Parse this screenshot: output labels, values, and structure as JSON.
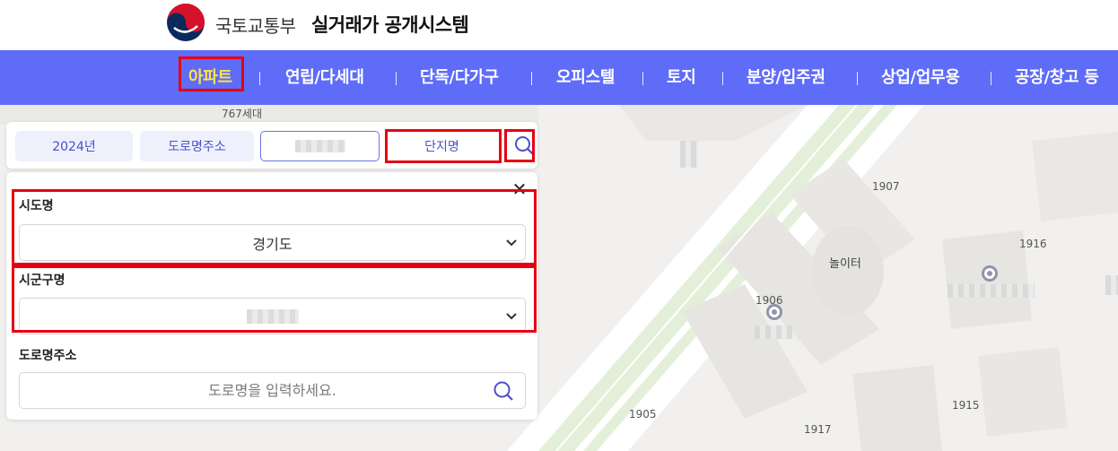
{
  "header": {
    "org_name": "국토교통부",
    "system_name": "실거래가 공개시스템"
  },
  "nav": {
    "items": [
      {
        "label": "아파트",
        "active": true
      },
      {
        "label": "연립/다세대"
      },
      {
        "label": "단독/다가구"
      },
      {
        "label": "오피스텔"
      },
      {
        "label": "토지"
      },
      {
        "label": "분양/입주권"
      },
      {
        "label": "상업/업무용"
      },
      {
        "label": "공장/창고 등"
      }
    ]
  },
  "filter_bar": {
    "year": "2024년",
    "road_address": "도로명주소",
    "complex_name": "단지명",
    "search_icon": "search-icon"
  },
  "panel": {
    "close_icon": "close-icon",
    "sido_label": "시도명",
    "sido_value": "경기도",
    "sigungu_label": "시군구명",
    "road_label": "도로명주소",
    "road_placeholder": "도로명을 입력하세요."
  },
  "map": {
    "labels": {
      "households": "767세대",
      "b1907": "1907",
      "b1916": "1916",
      "b1906": "1906",
      "b1905": "1905",
      "b1917": "1917",
      "b1915": "1915",
      "playground": "놀이터"
    }
  },
  "colors": {
    "nav_bg": "#5f6cf8",
    "active_nav": "#ffe34b",
    "highlight": "#e60012",
    "accent": "#4a52c9"
  }
}
